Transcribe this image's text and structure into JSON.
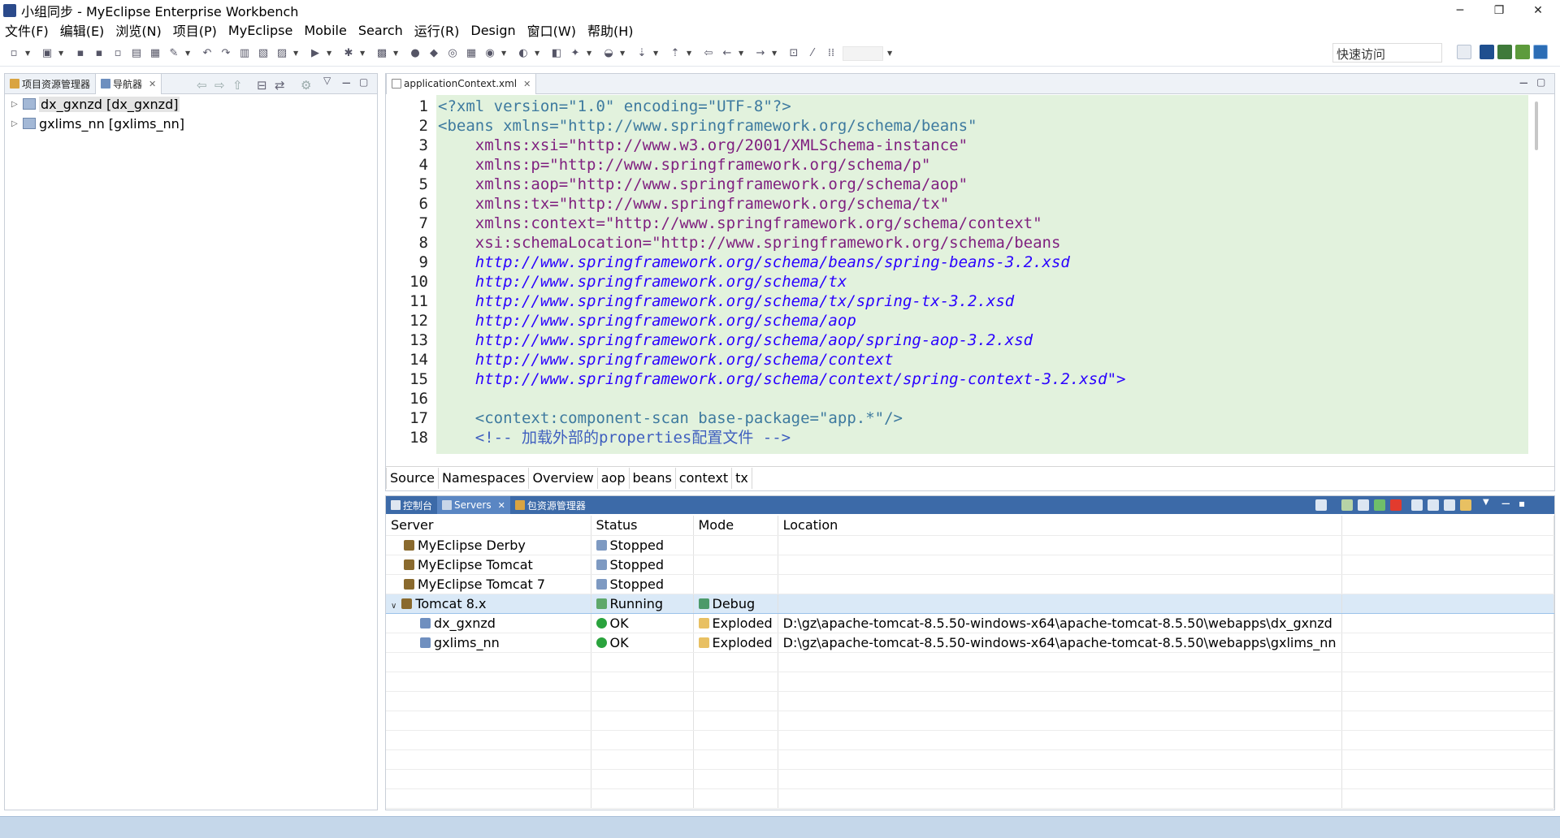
{
  "window": {
    "title": "小组同步 - MyEclipse Enterprise Workbench",
    "minimize": "─",
    "restore": "❐",
    "close": "✕"
  },
  "menu": [
    "文件(F)",
    "编辑(E)",
    "浏览(N)",
    "项目(P)",
    "MyEclipse",
    "Mobile",
    "Search",
    "运行(R)",
    "Design",
    "窗口(W)",
    "帮助(H)"
  ],
  "toolbar": {
    "quick_access_placeholder": "快速访问"
  },
  "left_panel": {
    "tabs": [
      {
        "label": "项目资源管理器",
        "active": false
      },
      {
        "label": "导航器",
        "active": true
      }
    ],
    "tree": [
      {
        "label": "dx_gxnzd [dx_gxnzd]",
        "selected": true
      },
      {
        "label": "gxlims_nn [gxlims_nn]",
        "selected": false
      }
    ]
  },
  "editor": {
    "tab_label": "applicationContext.xml",
    "line_numbers": [
      "1",
      "2",
      "3",
      "4",
      "5",
      "6",
      "7",
      "8",
      "9",
      "10",
      "11",
      "12",
      "13",
      "14",
      "15",
      "16",
      "17",
      "18"
    ],
    "bottom_tabs": [
      "Source",
      "Namespaces",
      "Overview",
      "aop",
      "beans",
      "context",
      "tx"
    ],
    "active_bottom_tab": "Source"
  },
  "servers_panel": {
    "tabs": [
      {
        "label": "控制台",
        "active": false
      },
      {
        "label": "Servers",
        "active": true
      },
      {
        "label": "包资源管理器",
        "active": false
      }
    ],
    "columns": [
      "Server",
      "Status",
      "Mode",
      "Location"
    ],
    "rows": [
      {
        "server": "MyEclipse Derby",
        "status": "Stopped",
        "mode": "",
        "location": "",
        "indent": 1
      },
      {
        "server": "MyEclipse Tomcat",
        "status": "Stopped",
        "mode": "",
        "location": "",
        "indent": 1
      },
      {
        "server": "MyEclipse Tomcat 7",
        "status": "Stopped",
        "mode": "",
        "location": "",
        "indent": 1
      },
      {
        "server": "Tomcat  8.x",
        "status": "Running",
        "mode": "Debug",
        "location": "",
        "indent": 1,
        "expanded": true,
        "selected": true
      },
      {
        "server": "dx_gxnzd",
        "status": "OK",
        "mode": "Exploded",
        "location": "D:\\gz\\apache-tomcat-8.5.50-windows-x64\\apache-tomcat-8.5.50\\webapps\\dx_gxnzd",
        "indent": 2
      },
      {
        "server": "gxlims_nn",
        "status": "OK",
        "mode": "Exploded",
        "location": "D:\\gz\\apache-tomcat-8.5.50-windows-x64\\apache-tomcat-8.5.50\\webapps\\gxlims_nn",
        "indent": 2
      }
    ]
  },
  "code": {
    "l1": "<?xml version=\"1.0\" encoding=\"UTF-8\"?>",
    "l2": "<beans xmlns=\"http://www.springframework.org/schema/beans\"",
    "l3": "    xmlns:xsi=\"http://www.w3.org/2001/XMLSchema-instance\"",
    "l4": "    xmlns:p=\"http://www.springframework.org/schema/p\"",
    "l5": "    xmlns:aop=\"http://www.springframework.org/schema/aop\"",
    "l6": "    xmlns:tx=\"http://www.springframework.org/schema/tx\"",
    "l7": "    xmlns:context=\"http://www.springframework.org/schema/context\"",
    "l8": "    xsi:schemaLocation=\"http://www.springframework.org/schema/beans",
    "l9": "    http://www.springframework.org/schema/beans/spring-beans-3.2.xsd",
    "l10": "    http://www.springframework.org/schema/tx",
    "l11": "    http://www.springframework.org/schema/tx/spring-tx-3.2.xsd",
    "l12": "    http://www.springframework.org/schema/aop",
    "l13": "    http://www.springframework.org/schema/aop/spring-aop-3.2.xsd",
    "l14": "    http://www.springframework.org/schema/context",
    "l15": "    http://www.springframework.org/schema/context/spring-context-3.2.xsd\">",
    "l16": "",
    "l17": "    <context:component-scan base-package=\"app.*\"/>",
    "l18": "    <!-- 加载外部的properties配置文件 -->"
  }
}
